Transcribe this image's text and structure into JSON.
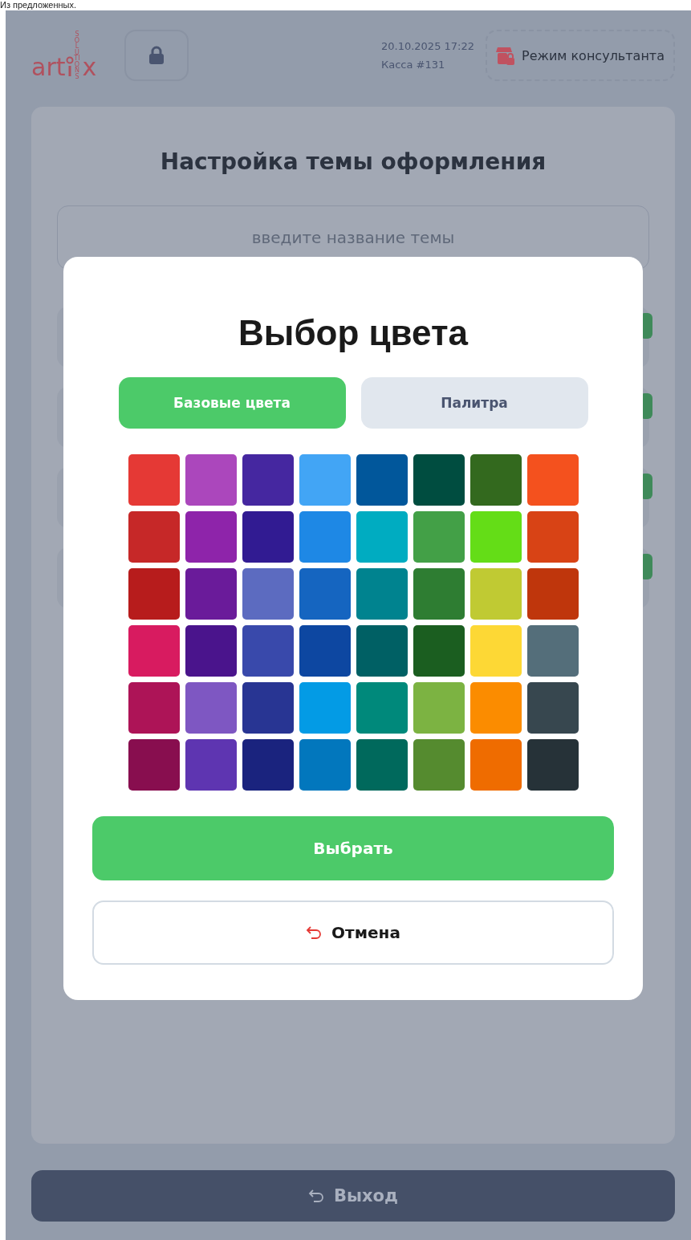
{
  "top_caption": "Из предложенных.",
  "header": {
    "logo": {
      "left": "art",
      "right": "x",
      "tagline": "SOLUTIONS"
    },
    "date_time": "20.10.2025 17:22",
    "register": "Касса #131",
    "consultant_button": "Режим консультанта"
  },
  "settings_card": {
    "title": "Настройка темы оформления",
    "name_field": {
      "placeholder": "введите название темы"
    },
    "rows": [
      {
        "on": true
      },
      {
        "on": true
      },
      {
        "on": true
      },
      {
        "on": true
      }
    ]
  },
  "dialog": {
    "title": "Выбор цвета",
    "tabs": [
      {
        "label": "Базовые цвета",
        "selected": true
      },
      {
        "label": "Палитра",
        "selected": false
      }
    ],
    "swatches": [
      [
        {
          "color": "#e53935"
        },
        {
          "color": "#ab47bc"
        },
        {
          "color": "#4527a0"
        },
        {
          "color": "#42a5f5"
        },
        {
          "color": "#01579b"
        },
        {
          "color": "#004d40"
        },
        {
          "color": "#33691e"
        },
        {
          "color": "#f4511e"
        }
      ],
      [
        {
          "color": "#c62828"
        },
        {
          "color": "#8e24aa"
        },
        {
          "color": "#311b92"
        },
        {
          "color": "#1e88e5"
        },
        {
          "color": "#00acc1"
        },
        {
          "color": "#43a047"
        },
        {
          "color": "#64dd17"
        },
        {
          "color": "#d84315"
        }
      ],
      [
        {
          "color": "#b71c1c"
        },
        {
          "color": "#6a1b9a"
        },
        {
          "color": "#5c6bc0"
        },
        {
          "color": "#1565c0"
        },
        {
          "color": "#00838f"
        },
        {
          "color": "#2e7d32"
        },
        {
          "color": "#c0ca33"
        },
        {
          "color": "#bf360c"
        }
      ],
      [
        {
          "color": "#d81b60"
        },
        {
          "color": "#4a148c"
        },
        {
          "color": "#3949ab"
        },
        {
          "color": "#0d47a1"
        },
        {
          "color": "#006064"
        },
        {
          "color": "#1b5e20"
        },
        {
          "color": "#fdd835"
        },
        {
          "color": "#546e7a"
        }
      ],
      [
        {
          "color": "#ad1457"
        },
        {
          "color": "#7e57c2"
        },
        {
          "color": "#283593"
        },
        {
          "color": "#039be5"
        },
        {
          "color": "#00897b"
        },
        {
          "color": "#7cb342"
        },
        {
          "color": "#fb8c00"
        },
        {
          "color": "#37474f"
        }
      ],
      [
        {
          "color": "#880e4f"
        },
        {
          "color": "#5e35b1"
        },
        {
          "color": "#1a237e"
        },
        {
          "color": "#0277bd"
        },
        {
          "color": "#00695c"
        },
        {
          "color": "#558b2f"
        },
        {
          "color": "#ef6c00"
        },
        {
          "color": "#263238"
        }
      ]
    ],
    "select_button": "Выбрать",
    "cancel_button": "Отмена"
  },
  "exit_button": "Выход"
}
